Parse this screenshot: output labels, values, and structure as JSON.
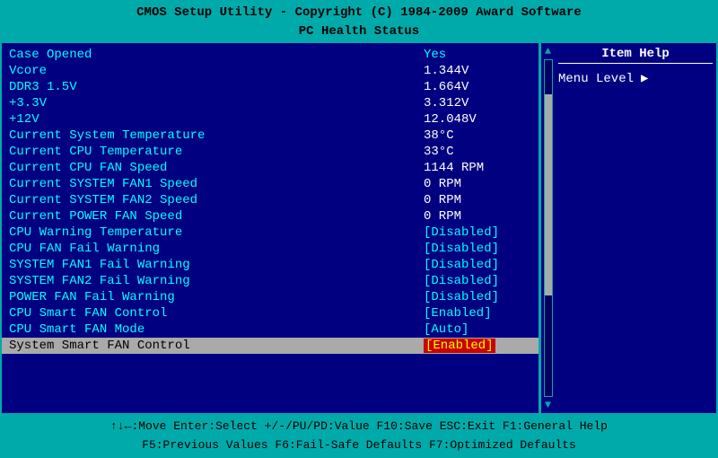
{
  "title": {
    "line1": "CMOS Setup Utility - Copyright (C) 1984-2009 Award Software",
    "line2": "PC Health Status"
  },
  "help": {
    "title": "Item Help",
    "menu_level_label": "Menu Level",
    "arrow": "▶"
  },
  "rows": [
    {
      "label": "Case Opened",
      "value": "Yes",
      "style": "cyan",
      "selected": false
    },
    {
      "label": "Vcore",
      "value": "1.344V",
      "style": "white",
      "selected": false
    },
    {
      "label": "DDR3 1.5V",
      "value": "1.664V",
      "style": "white",
      "selected": false
    },
    {
      "label": "+3.3V",
      "value": "3.312V",
      "style": "white",
      "selected": false
    },
    {
      "label": "+12V",
      "value": "12.048V",
      "style": "white",
      "selected": false
    },
    {
      "label": "Current System Temperature",
      "value": "38°C",
      "style": "white",
      "selected": false
    },
    {
      "label": "Current CPU Temperature",
      "value": "33°C",
      "style": "white",
      "selected": false
    },
    {
      "label": "Current CPU FAN Speed",
      "value": "1144 RPM",
      "style": "white",
      "selected": false
    },
    {
      "label": "Current SYSTEM FAN1 Speed",
      "value": "0 RPM",
      "style": "white",
      "selected": false
    },
    {
      "label": "Current SYSTEM FAN2 Speed",
      "value": "0 RPM",
      "style": "white",
      "selected": false
    },
    {
      "label": "Current POWER FAN Speed",
      "value": "0 RPM",
      "style": "white",
      "selected": false
    },
    {
      "label": "CPU Warning Temperature",
      "value": "[Disabled]",
      "style": "cyan",
      "selected": false
    },
    {
      "label": "CPU FAN Fail Warning",
      "value": "[Disabled]",
      "style": "cyan",
      "selected": false
    },
    {
      "label": "SYSTEM FAN1 Fail Warning",
      "value": "[Disabled]",
      "style": "cyan",
      "selected": false
    },
    {
      "label": "SYSTEM FAN2 Fail Warning",
      "value": "[Disabled]",
      "style": "cyan",
      "selected": false
    },
    {
      "label": "POWER FAN Fail Warning",
      "value": "[Disabled]",
      "style": "cyan",
      "selected": false
    },
    {
      "label": "CPU Smart FAN Control",
      "value": "[Enabled]",
      "style": "cyan",
      "selected": false
    },
    {
      "label": "CPU Smart FAN Mode",
      "value": "[Auto]",
      "style": "cyan",
      "selected": false
    },
    {
      "label": "System Smart FAN Control",
      "value": "[Enabled]",
      "style": "red",
      "selected": true
    }
  ],
  "nav": {
    "line1": "↑↓←:Move   Enter:Select   +/-/PU/PD:Value   F10:Save   ESC:Exit   F1:General Help",
    "line2": "F5:Previous Values   F6:Fail-Safe Defaults   F7:Optimized Defaults"
  }
}
